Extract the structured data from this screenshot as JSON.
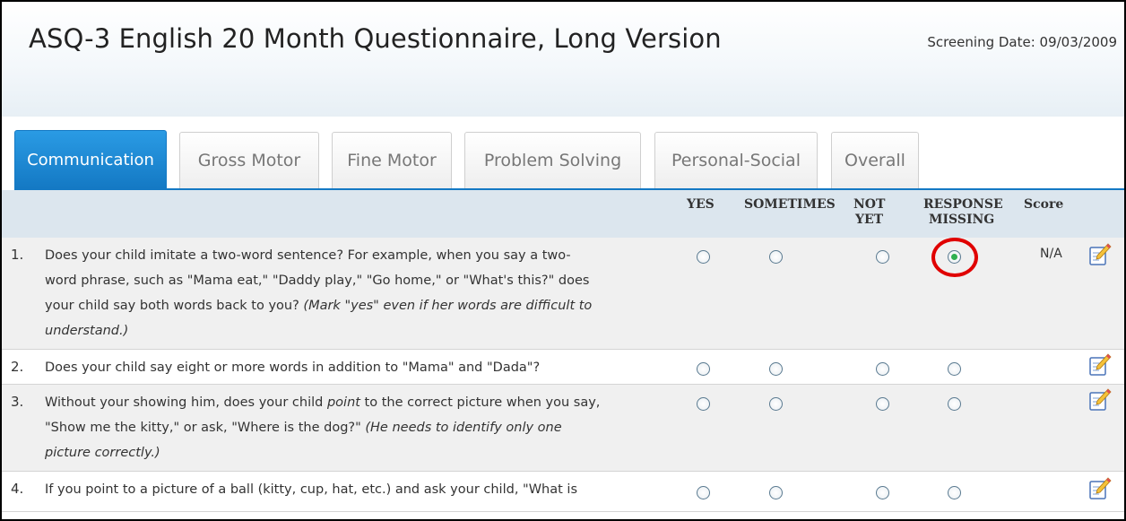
{
  "header": {
    "title": "ASQ-3 English 20 Month Questionnaire, Long Version",
    "screening_date": "Screening Date: 09/03/2009"
  },
  "tabs": [
    {
      "label": "Communication",
      "active": true
    },
    {
      "label": "Gross Motor",
      "active": false
    },
    {
      "label": "Fine Motor",
      "active": false
    },
    {
      "label": "Problem Solving",
      "active": false
    },
    {
      "label": "Personal-Social",
      "active": false
    },
    {
      "label": "Overall",
      "active": false
    }
  ],
  "columns": {
    "yes": "YES",
    "sometimes": "SOMETIMES",
    "not": "NOT",
    "yet": "YET",
    "response": "RESPONSE",
    "missing": "MISSING",
    "score": "Score"
  },
  "questions": [
    {
      "num": "1.",
      "line1": "Does your child imitate a two-word sentence? For example, when you say a two-",
      "line2": "word phrase, such as \"Mama eat,\" \"Daddy play,\" \"Go home,\" or \"What's this?\" does",
      "line3": "your child say both words back to you? ",
      "line3_italic": "(Mark \"yes\" even if her words are difficult to",
      "line4_italic": "understand.)",
      "selected": "response_missing",
      "score": "N/A"
    },
    {
      "num": "2.",
      "line1": "Does your child say eight or more words in addition to \"Mama\" and \"Dada\"?",
      "selected": "none",
      "score": ""
    },
    {
      "num": "3.",
      "line1_a": "Without your showing him, does your child ",
      "line1_italic": "point",
      "line1_b": " to the correct picture when you say,",
      "line2": "\"Show me the kitty,\" or ask, \"Where is the dog?\" ",
      "line2_italic": "(He needs to identify only one",
      "line3_italic": "picture correctly.)",
      "selected": "none",
      "score": ""
    },
    {
      "num": "4.",
      "line1": "If you point to a picture of a ball (kitty, cup, hat, etc.) and ask your child, \"What is",
      "selected": "none",
      "score": ""
    }
  ],
  "colors": {
    "tab_active": "#1479c4",
    "header_band": "#dce6ee",
    "highlight_circle": "#e00000",
    "radio_selected": "#2fb050"
  },
  "icons": {
    "edit": "edit-pencil-icon"
  }
}
